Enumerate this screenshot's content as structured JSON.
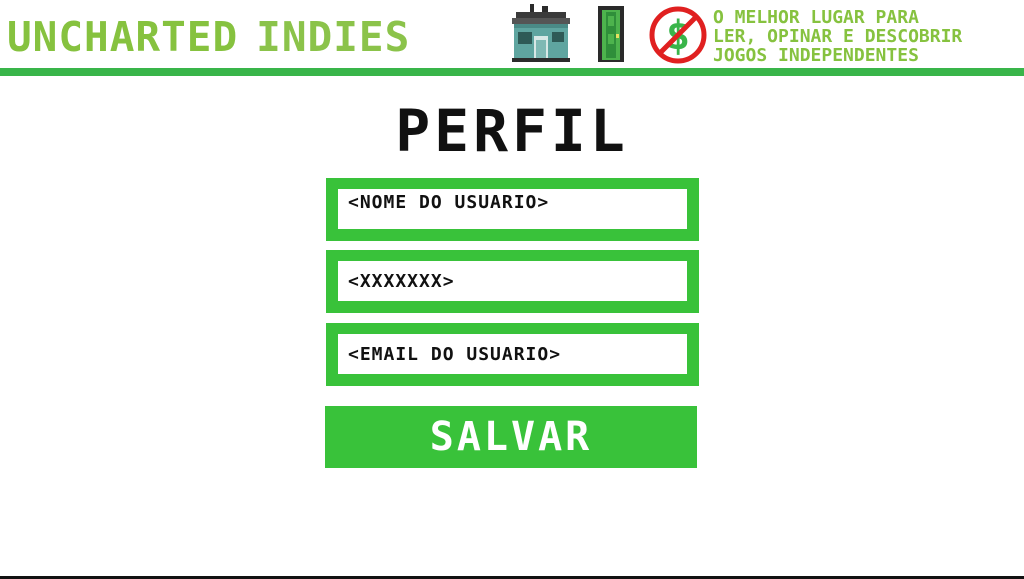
{
  "header": {
    "brand_word_1": "UNCHARTED",
    "brand_word_2": "INDIES",
    "icons": [
      "house-icon",
      "door-icon",
      "no-money-icon"
    ],
    "tagline": [
      "O MELHOR LUGAR PARA",
      "LER, OPINAR E DESCOBRIR",
      "JOGOS INDEPENDENTES"
    ]
  },
  "profile": {
    "title": "PERFIL",
    "username_field": "<NOME DO USUARIO>",
    "password_field": "<XXXXXXX>",
    "email_field": "<EMAIL DO USUARIO>",
    "save_label": "SALVAR"
  },
  "colors": {
    "accent_green": "#39c23a",
    "brand_green": "#86c23f",
    "text": "#111111",
    "background": "#ffffff",
    "no_sign_red": "#e02020"
  }
}
